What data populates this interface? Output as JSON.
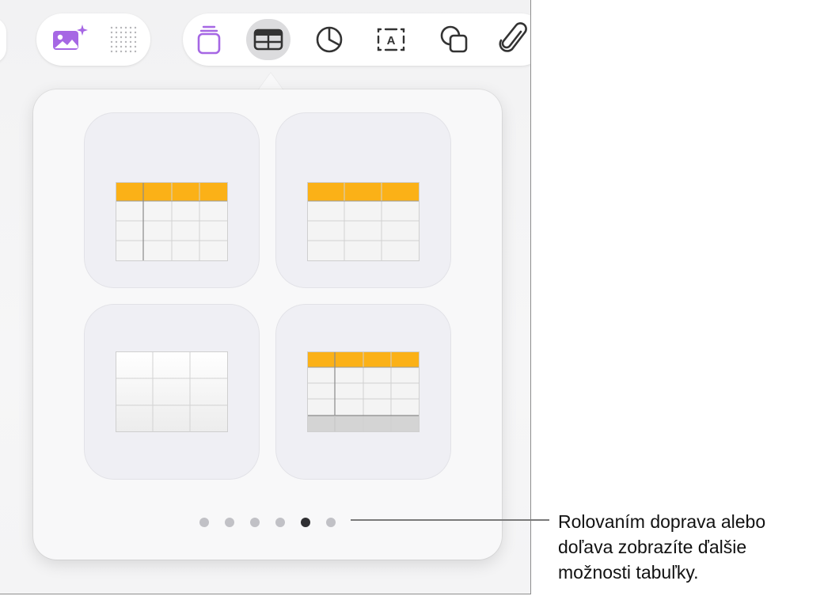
{
  "toolbar": {
    "media_group": [
      {
        "name": "media-sparkle-icon",
        "color": "#a667e4"
      },
      {
        "name": "dot-grid-icon",
        "color": "#b5b5b8"
      }
    ],
    "main_group": [
      {
        "name": "text-format-icon",
        "color": "#a667e4"
      },
      {
        "name": "table-icon",
        "color": "#333333",
        "selected": true
      },
      {
        "name": "chart-icon",
        "color": "#333333"
      },
      {
        "name": "text-box-icon",
        "color": "#333333",
        "glyph": "A"
      },
      {
        "name": "shapes-icon",
        "color": "#333333"
      },
      {
        "name": "attachment-icon",
        "color": "#333333"
      }
    ]
  },
  "popover": {
    "table_styles": [
      {
        "name": "table-style-header-row-and-column",
        "header_color": "#fbb117"
      },
      {
        "name": "table-style-header-row",
        "header_color": "#fbb117"
      },
      {
        "name": "table-style-plain",
        "header_color": "#ffffff"
      },
      {
        "name": "table-style-header-and-footer",
        "header_color": "#fbb117"
      }
    ],
    "page_indicator": {
      "count": 6,
      "current": 5
    }
  },
  "callout": {
    "lines": [
      "Rolovaním doprava alebo",
      "doľava zobrazíte ďalšie",
      "možnosti tabuľky."
    ]
  },
  "colors": {
    "accent_purple": "#a667e4",
    "table_header_yellow": "#fbb117",
    "active_dot": "#303033",
    "inactive_dot": "#c1c1c6"
  }
}
